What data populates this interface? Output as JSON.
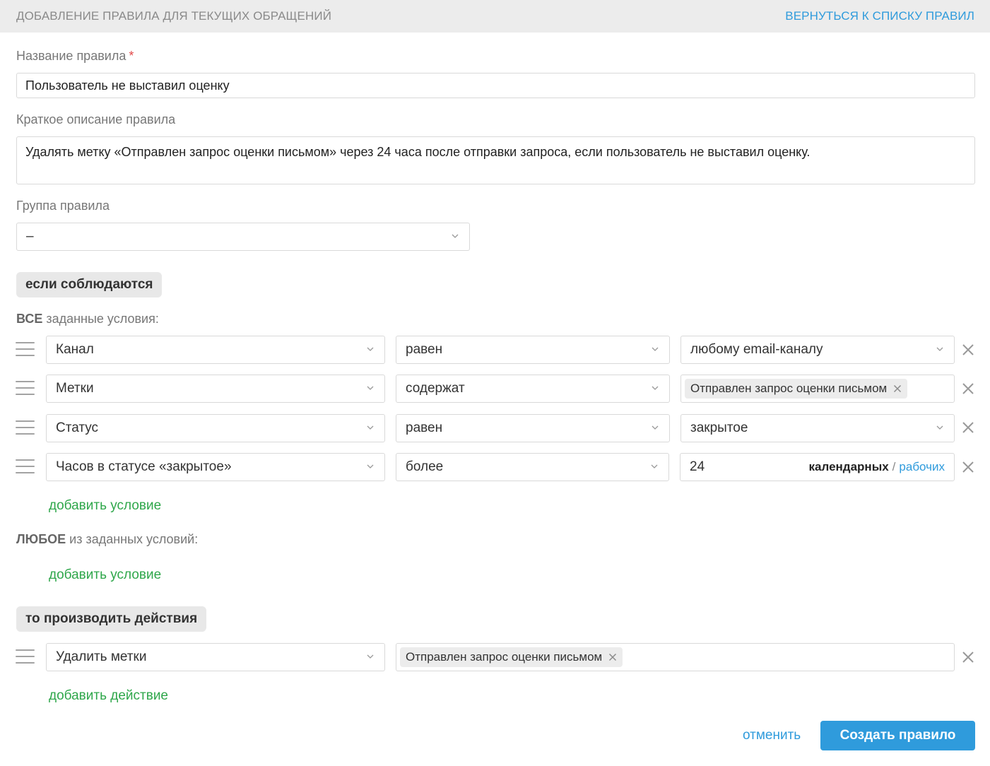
{
  "header": {
    "title": "ДОБАВЛЕНИЕ ПРАВИЛА ДЛЯ ТЕКУЩИХ ОБРАЩЕНИЙ",
    "back_link": "ВЕРНУТЬСЯ К СПИСКУ ПРАВИЛ"
  },
  "form": {
    "name_label": "Название правила",
    "name_required_mark": "*",
    "name_value": "Пользователь не выставил оценку",
    "description_label": "Краткое описание правила",
    "description_value": "Удалять метку «Отправлен запрос оценки письмом» через 24 часа после отправки запроса, если пользователь не выставил оценку.",
    "group_label": "Группа правила",
    "group_value": "–"
  },
  "conditions": {
    "if_pill": "если соблюдаются",
    "all_bold": "ВСЕ",
    "all_rest": " заданные условия:",
    "rows": [
      {
        "field": "Канал",
        "operator": "равен",
        "value": "любому email-каналу"
      },
      {
        "field": "Метки",
        "operator": "содержат",
        "tag": "Отправлен запрос оценки письмом"
      },
      {
        "field": "Статус",
        "operator": "равен",
        "value": "закрытое"
      },
      {
        "field": "Часов в статусе «закрытое»",
        "operator": "более",
        "number": "24",
        "unit_selected": "календарных",
        "unit_separator": "/",
        "unit_alt": "рабочих"
      }
    ],
    "add_condition_all": "добавить условие",
    "any_bold": "ЛЮБОЕ",
    "any_rest": " из заданных условий:",
    "add_condition_any": "добавить условие"
  },
  "actions": {
    "then_pill": "то производить действия",
    "rows": [
      {
        "action": "Удалить метки",
        "tag": "Отправлен запрос оценки письмом"
      }
    ],
    "add_action": "добавить действие"
  },
  "footer": {
    "cancel": "отменить",
    "submit": "Создать правило"
  },
  "colors": {
    "accent_blue": "#2f9bdc",
    "add_green": "#2fa74b",
    "required_red": "#e24a4a",
    "header_bg": "#ececec"
  },
  "icons": [
    "chevron-down-icon",
    "close-icon",
    "drag-handle-icon",
    "tag-remove-icon"
  ]
}
